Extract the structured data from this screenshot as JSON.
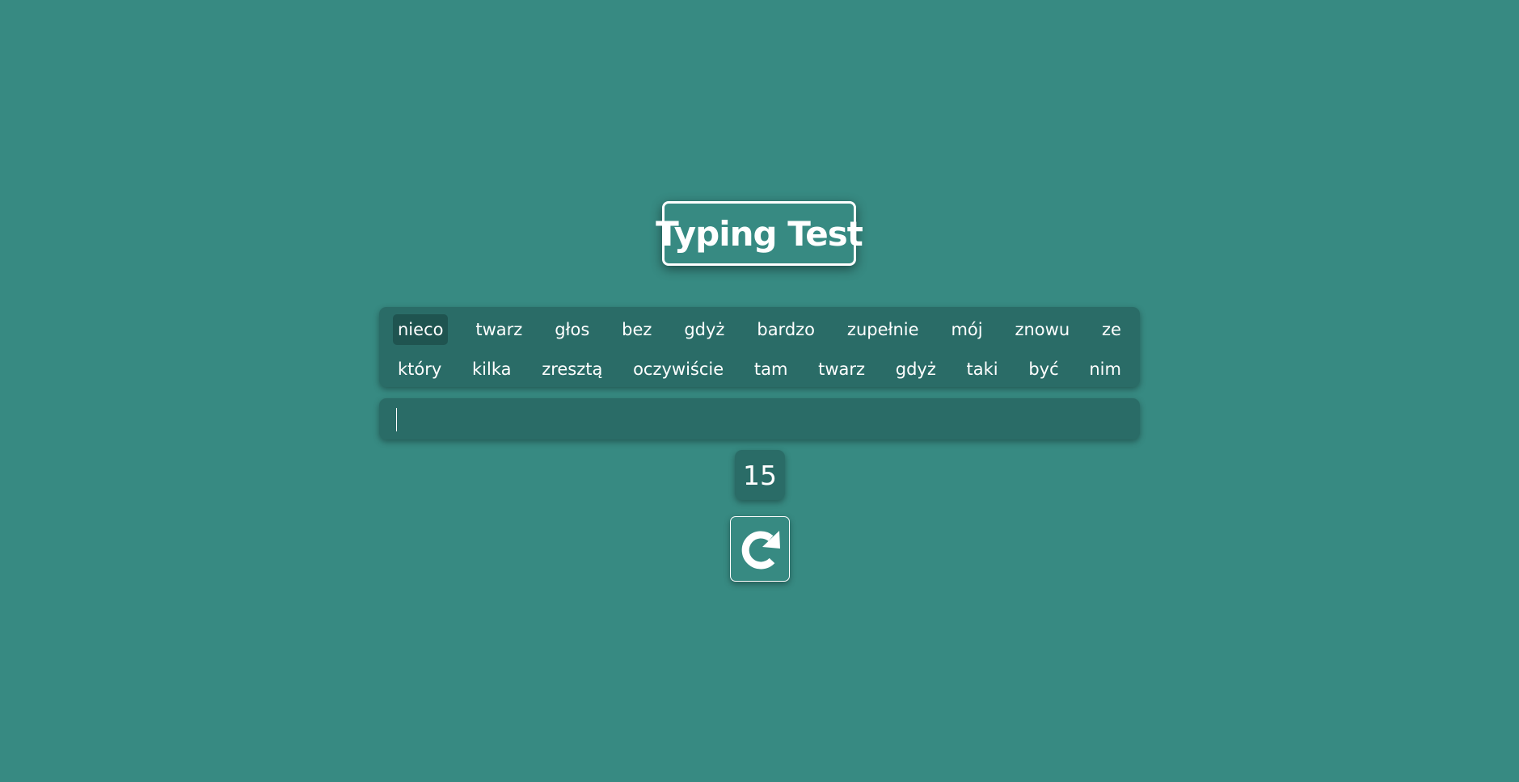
{
  "header": {
    "title": "Typing Test"
  },
  "words": {
    "row1": [
      "nieco",
      "twarz",
      "głos",
      "bez",
      "gdyż",
      "bardzo",
      "zupełnie",
      "mój",
      "znowu",
      "ze"
    ],
    "row2": [
      "który",
      "kilka",
      "zresztą",
      "oczywiście",
      "tam",
      "twarz",
      "gdyż",
      "taki",
      "być",
      "nim"
    ],
    "active_index": 0
  },
  "input": {
    "value": "",
    "placeholder": ""
  },
  "timer": {
    "seconds": "15"
  },
  "restart": {
    "icon": "restart-icon"
  },
  "colors": {
    "background": "#378a82",
    "panel": "#2a6c67",
    "active_word": "#1f5450",
    "text": "#ffffff"
  }
}
